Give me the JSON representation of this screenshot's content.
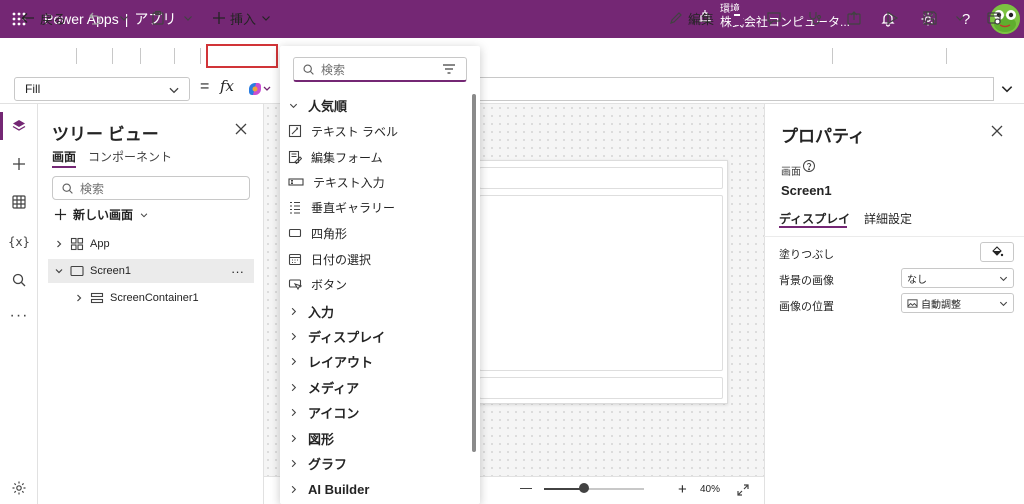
{
  "app": {
    "brand": "Power Apps",
    "separator": "|",
    "section": "アプリ"
  },
  "environment": {
    "label": "環境",
    "name": "株式会社コンピュータ..."
  },
  "commandbar": {
    "back_label": "戻る",
    "insert_label": "挿入",
    "edit_label": "編集"
  },
  "formula": {
    "property": "Fill",
    "equals": "=",
    "fx": "fx"
  },
  "tree": {
    "title": "ツリー ビュー",
    "tabs": [
      "画面",
      "コンポーネント"
    ],
    "search_placeholder": "検索",
    "new_screen": "新しい画面",
    "nodes": [
      {
        "label": "App"
      },
      {
        "label": "Screen1",
        "more": "···"
      },
      {
        "label": "ScreenContainer1"
      }
    ]
  },
  "insert_menu": {
    "search_placeholder": "検索",
    "popular_header": "人気順",
    "items": [
      "テキスト ラベル",
      "編集フォーム",
      "テキスト入力",
      "垂直ギャラリー",
      "四角形",
      "日付の選択",
      "ボタン"
    ],
    "categories": [
      "入力",
      "ディスプレイ",
      "レイアウト",
      "メディア",
      "アイコン",
      "図形",
      "グラフ",
      "AI Builder"
    ]
  },
  "canvas": {
    "zoom": "40%",
    "zoom_level": 0.4
  },
  "properties": {
    "title": "プロパティ",
    "screen_label": "画面",
    "screen_name": "Screen1",
    "tabs": [
      "ディスプレイ",
      "詳細設定"
    ],
    "rows": [
      {
        "label": "塗りつぶし"
      },
      {
        "label": "背景の画像",
        "value": "なし"
      },
      {
        "label": "画像の位置",
        "value": "自動調整"
      }
    ]
  },
  "colors": {
    "brand": "#742774",
    "highlight": "#d13438"
  }
}
